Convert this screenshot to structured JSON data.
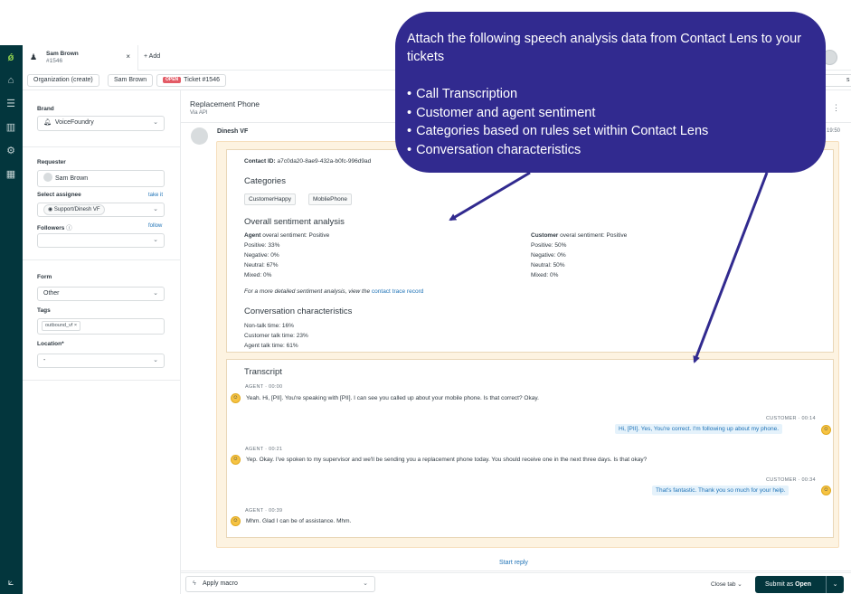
{
  "tabs": [
    {
      "name": "Sam Brown",
      "sub": "#1546",
      "close": "×"
    }
  ],
  "add_tab": "+ Add",
  "breadcrumbs": {
    "org": "Organization (create)",
    "user": "Sam Brown",
    "status_badge": "OPEN",
    "ticket": "Ticket #1546",
    "right_partial": "s"
  },
  "props": {
    "brand_label": "Brand",
    "brand_value": "VoiceFoundry",
    "requester_label": "Requester",
    "requester_value": "Sam Brown",
    "assignee_label": "Select assignee",
    "take_it": "take it",
    "assignee_value": "Support/Dinesh VF",
    "followers_label": "Followers",
    "follow": "follow",
    "form_label": "Form",
    "form_value": "Other",
    "tags_label": "Tags",
    "tag": "outbound_vf",
    "location_label": "Location*",
    "location_value": "-"
  },
  "ticket": {
    "title": "Replacement Phone",
    "via": "Via API",
    "author": "Dinesh VF",
    "time": "19:50",
    "contact_id_label": "Contact ID:",
    "contact_id": "a7c0da20-8ae9-432a-b0fc-996d9ad",
    "categories_title": "Categories",
    "categories": [
      "CustomerHappy",
      "MobliePhone"
    ],
    "sentiment_title": "Overall sentiment analysis",
    "agent": {
      "label": "Agent",
      "overall": "overal sentiment: Positive",
      "positive": "Positive: 33%",
      "negative": "Negative: 0%",
      "neutral": "Neutral: 67%",
      "mixed": "Mixed: 0%"
    },
    "customer": {
      "label": "Customer",
      "overall": "overal sentiment: Positive",
      "positive": "Positive: 50%",
      "negative": "Negative: 0%",
      "neutral": "Neutral: 50%",
      "mixed": "Mixed: 0%"
    },
    "detail_note": "For a more detailed sentiment analysis, view the",
    "detail_link": "contact trace record",
    "conv_title": "Conversation characteristics",
    "conv": [
      "Non-talk time: 16%",
      "Customer talk time: 23%",
      "Agent talk time: 61%"
    ],
    "transcript_title": "Transcript",
    "transcript": [
      {
        "meta": "AGENT · 00:00",
        "text": "Yeah. Hi, [PII]. You're speaking with [PII]. I can see you called up about your mobile phone. Is that correct? Okay."
      },
      {
        "meta": "CUSTOMER · 00:14",
        "text": "Hi, [PII]. Yes, You're correct. I'm following up about my phone."
      },
      {
        "meta": "AGENT · 00:21",
        "text": "Yep. Okay. I've spoken to my supervisor and we'll be sending you a replacement phone today. You should receive one in the next three days. Is that okay?"
      },
      {
        "meta": "CUSTOMER · 00:34",
        "text": "That's fantastic. Thank you so much for your help."
      },
      {
        "meta": "AGENT · 00:39",
        "text": "Mhm. Glad I can be of assistance. Mhm."
      }
    ],
    "start_reply": "Start reply"
  },
  "footer": {
    "macro": "Apply macro",
    "close_tab": "Close tab",
    "submit_prefix": "Submit as",
    "submit_status": "Open"
  },
  "callout": {
    "intro": "Attach the following speech analysis data from Contact Lens to your tickets",
    "items": [
      "Call Transcription",
      "Customer and agent sentiment",
      "Categories based on rules set within Contact Lens",
      "Conversation characteristics"
    ]
  },
  "colors": {
    "rail": "#03363d",
    "callout": "#312a8f",
    "link": "#1f73b7",
    "card": "#fdf3e1"
  }
}
